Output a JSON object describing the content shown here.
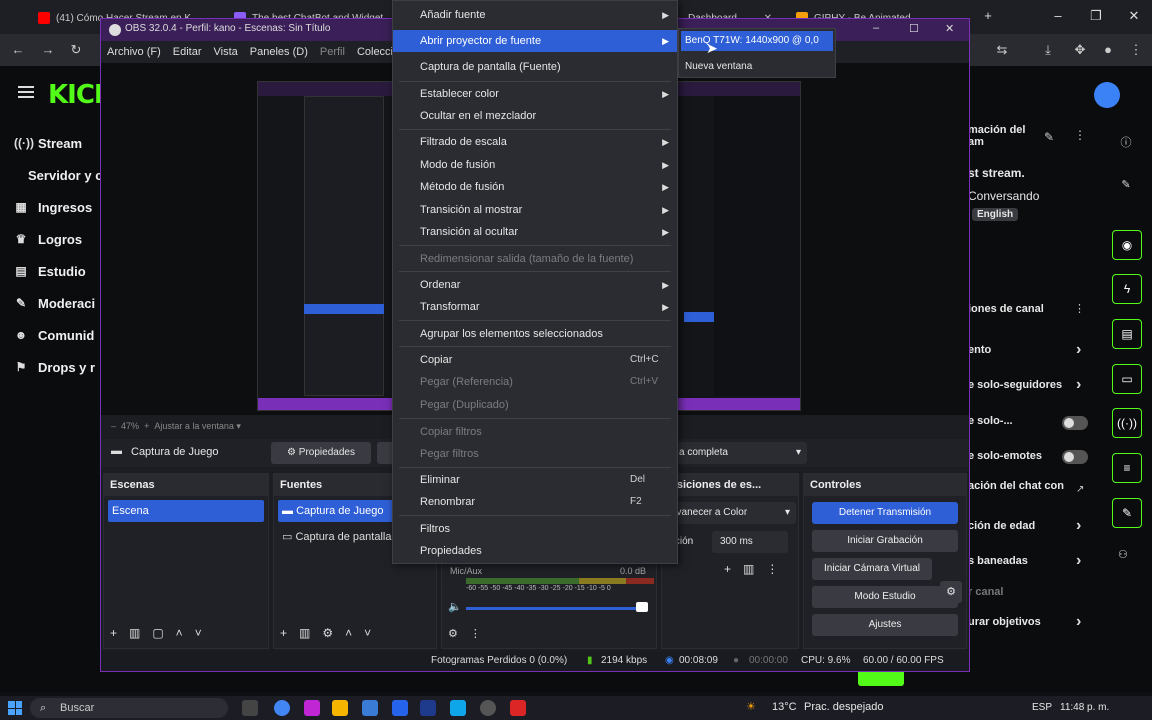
{
  "browser": {
    "tabs": [
      {
        "label": "(41) Cómo Hacer Stream en K",
        "color": "#ff0000"
      },
      {
        "label": "The best ChatBot and Widget",
        "color": "#8b5cf6"
      },
      {
        "label": "Dashboard",
        "color": "#53fc18"
      },
      {
        "label": "GIPHY - Be Animated",
        "color": "#f59e0b"
      }
    ]
  },
  "kick": {
    "logo": "KICK",
    "sidebar": [
      {
        "label": "Stream",
        "icon": "broadcast-icon"
      },
      {
        "label": "Servidor y c",
        "icon": ""
      },
      {
        "label": "Ingresos",
        "icon": "money-icon"
      },
      {
        "label": "Logros",
        "icon": "trophy-icon"
      },
      {
        "label": "Estudio",
        "icon": "studio-icon"
      },
      {
        "label": "Moderaci",
        "icon": "wrench-icon"
      },
      {
        "label": "Comunid",
        "icon": "community-icon"
      },
      {
        "label": "Drops y r",
        "icon": "gift-icon"
      }
    ],
    "info": {
      "title": "mación del",
      "title2": "am",
      "stream": "st stream.",
      "category": "Conversando",
      "language": "English"
    },
    "channel_options": {
      "header": "iones de canal",
      "items": [
        {
          "label": "ento",
          "control": "chevron"
        },
        {
          "label": "e solo-seguidores",
          "control": "chevron"
        },
        {
          "label": "e solo-...",
          "control": "toggle"
        },
        {
          "label": "e solo-emotes",
          "control": "toggle"
        },
        {
          "label": "ación del chat con",
          "control": "link"
        },
        {
          "label": "ción de edad",
          "control": "chevron"
        },
        {
          "label": "s baneadas",
          "control": "chevron"
        },
        {
          "label": "r canal",
          "control": "none"
        },
        {
          "label": "urar objetivos",
          "control": "chevron"
        }
      ]
    }
  },
  "obs": {
    "title": "OBS 32.0.4 - Perfil: kano - Escenas: Sin Título",
    "menu": [
      "Archivo (F)",
      "Editar",
      "Vista",
      "Paneles (D)",
      "Perfil",
      "Colección"
    ],
    "zoom": "47%",
    "zoom_hint": "Ajustar a la ventana",
    "source_bar": {
      "source": "Captura de Juego",
      "properties": "Propiedades",
      "mode": "a completa"
    },
    "scenes": {
      "header": "Escenas",
      "items": [
        "Escena"
      ]
    },
    "sources": {
      "header": "Fuentes",
      "items": [
        "Captura de Juego",
        "Captura de pantalla"
      ]
    },
    "audio": {
      "label": "Mic/Aux",
      "level": "0.0 dB",
      "scale": "-60 -55 -50 -45 -40 -35 -30 -25 -20 -15 -10 -5 0"
    },
    "transitions": {
      "header": "ansiciones de es...",
      "effect": "esvanecer a Color",
      "duration_label": "ración",
      "duration": "300 ms"
    },
    "controls": {
      "header": "Controles",
      "buttons": [
        "Detener Transmisión",
        "Iniciar Grabación",
        "Iniciar Cámara Virtual",
        "Modo Estudio",
        "Ajustes"
      ]
    },
    "status": {
      "dropped": "Fotogramas Perdidos 0 (0.0%)",
      "kbps": "2194 kbps",
      "stream_time": "00:08:09",
      "rec_time": "00:00:00",
      "cpu": "CPU: 9.6%",
      "fps": "60.00 / 60.00 FPS"
    }
  },
  "context_menu": {
    "items": [
      {
        "label": "Añadir fuente",
        "arrow": true,
        "shortcut": "",
        "disabled": false,
        "highlight": false
      },
      {
        "label": "Abrir proyector de fuente",
        "arrow": true,
        "shortcut": "",
        "disabled": false,
        "highlight": true
      },
      {
        "label": "Captura de pantalla (Fuente)",
        "arrow": false,
        "shortcut": "",
        "disabled": false,
        "highlight": false
      },
      {
        "label": "Establecer color",
        "arrow": true,
        "shortcut": "",
        "disabled": false,
        "highlight": false
      },
      {
        "label": "Ocultar en el mezclador",
        "arrow": false,
        "shortcut": "",
        "disabled": false,
        "highlight": false
      },
      {
        "label": "Filtrado de escala",
        "arrow": true,
        "shortcut": "",
        "disabled": false,
        "highlight": false
      },
      {
        "label": "Modo de fusión",
        "arrow": true,
        "shortcut": "",
        "disabled": false,
        "highlight": false
      },
      {
        "label": "Método de fusión",
        "arrow": true,
        "shortcut": "",
        "disabled": false,
        "highlight": false
      },
      {
        "label": "Transición al mostrar",
        "arrow": true,
        "shortcut": "",
        "disabled": false,
        "highlight": false
      },
      {
        "label": "Transición al ocultar",
        "arrow": true,
        "shortcut": "",
        "disabled": false,
        "highlight": false
      },
      {
        "label": "Redimensionar salida (tamaño de la fuente)",
        "arrow": false,
        "shortcut": "",
        "disabled": true,
        "highlight": false
      },
      {
        "label": "Ordenar",
        "arrow": true,
        "shortcut": "",
        "disabled": false,
        "highlight": false
      },
      {
        "label": "Transformar",
        "arrow": true,
        "shortcut": "",
        "disabled": false,
        "highlight": false
      },
      {
        "label": "Agrupar los elementos seleccionados",
        "arrow": false,
        "shortcut": "",
        "disabled": false,
        "highlight": false
      },
      {
        "label": "Copiar",
        "arrow": false,
        "shortcut": "Ctrl+C",
        "disabled": false,
        "highlight": false
      },
      {
        "label": "Pegar (Referencia)",
        "arrow": false,
        "shortcut": "Ctrl+V",
        "disabled": true,
        "highlight": false
      },
      {
        "label": "Pegar (Duplicado)",
        "arrow": false,
        "shortcut": "",
        "disabled": true,
        "highlight": false
      },
      {
        "label": "Copiar filtros",
        "arrow": false,
        "shortcut": "",
        "disabled": true,
        "highlight": false
      },
      {
        "label": "Pegar filtros",
        "arrow": false,
        "shortcut": "",
        "disabled": true,
        "highlight": false
      },
      {
        "label": "Eliminar",
        "arrow": false,
        "shortcut": "Del",
        "disabled": false,
        "highlight": false
      },
      {
        "label": "Renombrar",
        "arrow": false,
        "shortcut": "F2",
        "disabled": false,
        "highlight": false
      },
      {
        "label": "Filtros",
        "arrow": false,
        "shortcut": "",
        "disabled": false,
        "highlight": false
      },
      {
        "label": "Propiedades",
        "arrow": false,
        "shortcut": "",
        "disabled": false,
        "highlight": false
      }
    ]
  },
  "submenu": {
    "items": [
      "BenQ T71W: 1440x900 @ 0,0",
      "Nueva ventana"
    ]
  },
  "taskbar": {
    "search_placeholder": "Buscar",
    "weather": "13°C",
    "weather_text": "Prac. despejado",
    "lang": "ESP",
    "time": "11:48 p. m."
  }
}
